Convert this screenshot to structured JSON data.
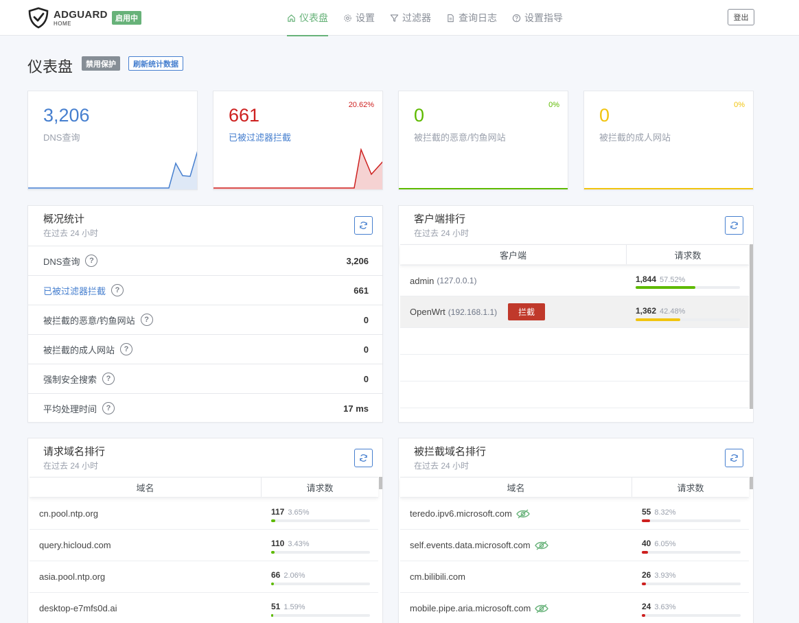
{
  "brand": {
    "name": "ADGUARD",
    "sub": "HOME",
    "status": "启用中"
  },
  "nav": [
    {
      "label": "仪表盘",
      "icon": "home-icon",
      "active": true
    },
    {
      "label": "设置",
      "icon": "gear-icon"
    },
    {
      "label": "过滤器",
      "icon": "filter-icon"
    },
    {
      "label": "查询日志",
      "icon": "document-icon"
    },
    {
      "label": "设置指导",
      "icon": "help-circle-icon"
    }
  ],
  "logout_label": "登出",
  "page": {
    "title": "仪表盘",
    "disable_label": "禁用保护",
    "refresh_label": "刷新统计数据"
  },
  "stats": [
    {
      "value": "3,206",
      "label": "DNS查询",
      "percent": "",
      "color": "#467fcf"
    },
    {
      "value": "661",
      "label": "已被过滤器拦截",
      "percent": "20.62%",
      "color": "#cd201f"
    },
    {
      "value": "0",
      "label": "被拦截的恶意/钓鱼网站",
      "percent": "0%",
      "color": "#5eba00"
    },
    {
      "value": "0",
      "label": "被拦截的成人网站",
      "percent": "0%",
      "color": "#f1c40f"
    }
  ],
  "summary": {
    "title": "概况统计",
    "subtitle": "在过去 24 小时",
    "rows": [
      {
        "label": "DNS查询",
        "value": "3,206"
      },
      {
        "label": "已被过滤器拦截",
        "value": "661"
      },
      {
        "label": "被拦截的恶意/钓鱼网站",
        "value": "0"
      },
      {
        "label": "被拦截的成人网站",
        "value": "0"
      },
      {
        "label": "强制安全搜索",
        "value": "0"
      },
      {
        "label": "平均处理时间",
        "value": "17 ms"
      }
    ]
  },
  "clients": {
    "title": "客户端排行",
    "subtitle": "在过去 24 小时",
    "col_client": "客户端",
    "col_count": "请求数",
    "block_label": "拦截",
    "rows": [
      {
        "name": "admin",
        "ip": "(127.0.0.1)",
        "count": "1,844",
        "percent": "57.52%",
        "ratio": 0.575,
        "color": "#5eba00"
      },
      {
        "name": "OpenWrt",
        "ip": "(192.168.1.1)",
        "count": "1,362",
        "percent": "42.48%",
        "ratio": 0.425,
        "color": "#f1c40f"
      }
    ]
  },
  "queried": {
    "title": "请求域名排行",
    "subtitle": "在过去 24 小时",
    "col_domain": "域名",
    "col_count": "请求数",
    "rows": [
      {
        "domain": "cn.pool.ntp.org",
        "count": "117",
        "percent": "3.65%",
        "ratio": 0.0365
      },
      {
        "domain": "query.hicloud.com",
        "count": "110",
        "percent": "3.43%",
        "ratio": 0.0343
      },
      {
        "domain": "asia.pool.ntp.org",
        "count": "66",
        "percent": "2.06%",
        "ratio": 0.0206
      },
      {
        "domain": "desktop-e7mfs0d.ai",
        "count": "51",
        "percent": "1.59%",
        "ratio": 0.0159
      }
    ]
  },
  "blocked": {
    "title": "被拦截域名排行",
    "subtitle": "在过去 24 小时",
    "col_domain": "域名",
    "col_count": "请求数",
    "rows": [
      {
        "domain": "teredo.ipv6.microsoft.com",
        "count": "55",
        "percent": "8.32%",
        "ratio": 0.0832,
        "eye": true
      },
      {
        "domain": "self.events.data.microsoft.com",
        "count": "40",
        "percent": "6.05%",
        "ratio": 0.0605,
        "eye": true
      },
      {
        "domain": "cm.bilibili.com",
        "count": "26",
        "percent": "3.93%",
        "ratio": 0.0393,
        "eye": false
      },
      {
        "domain": "mobile.pipe.aria.microsoft.com",
        "count": "24",
        "percent": "3.63%",
        "ratio": 0.0363,
        "eye": true
      }
    ]
  }
}
